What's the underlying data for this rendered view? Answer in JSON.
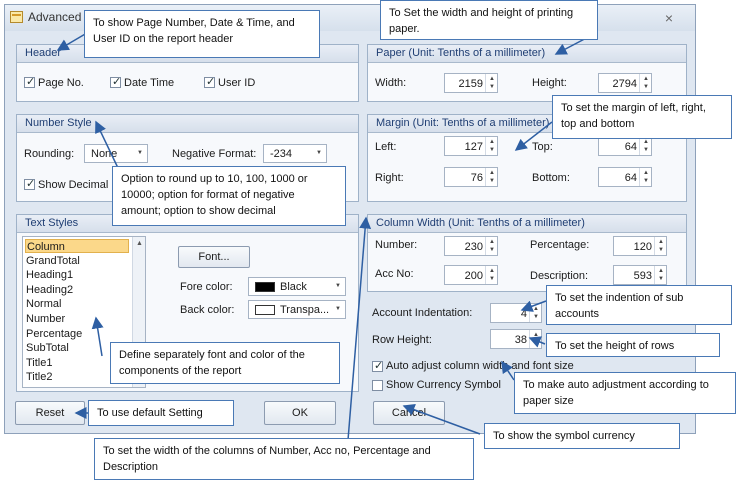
{
  "window": {
    "title": "Advanced",
    "close": "×"
  },
  "header": {
    "title": "Header",
    "page_no": {
      "label": "Page No.",
      "checked": true
    },
    "date_time": {
      "label": "Date Time",
      "checked": true
    },
    "user_id": {
      "label": "User ID",
      "checked": true
    }
  },
  "number_style": {
    "title": "Number Style",
    "rounding_label": "Rounding:",
    "rounding_value": "None",
    "negative_label": "Negative Format:",
    "negative_value": "-234",
    "show_decimal": {
      "label": "Show Decimal",
      "checked": true
    }
  },
  "text_styles": {
    "title": "Text Styles",
    "items": [
      "Column",
      "GrandTotal",
      "Heading1",
      "Heading2",
      "Normal",
      "Number",
      "Percentage",
      "SubTotal",
      "Title1",
      "Title2"
    ],
    "selected_index": 0,
    "font_button": "Font...",
    "fore_label": "Fore color:",
    "fore_value": "Black",
    "fore_swatch": "#000000",
    "back_label": "Back color:",
    "back_value": "Transpa...",
    "back_swatch": "#ffffff"
  },
  "paper": {
    "title": "Paper (Unit: Tenths of a millimeter)",
    "width_label": "Width:",
    "width_value": "2159",
    "height_label": "Height:",
    "height_value": "2794"
  },
  "margin": {
    "title": "Margin (Unit: Tenths of a millimeter)",
    "left_label": "Left:",
    "left_value": "127",
    "top_label": "Top:",
    "top_value": "64",
    "right_label": "Right:",
    "right_value": "76",
    "bottom_label": "Bottom:",
    "bottom_value": "64"
  },
  "column_width": {
    "title": "Column Width (Unit: Tenths of a millimeter)",
    "number_label": "Number:",
    "number_value": "230",
    "percentage_label": "Percentage:",
    "percentage_value": "120",
    "accno_label": "Acc No:",
    "accno_value": "200",
    "description_label": "Description:",
    "description_value": "593"
  },
  "indent": {
    "account_label": "Account Indentation:",
    "account_value": "4",
    "row_label": "Row Height:",
    "row_value": "38"
  },
  "options": {
    "auto_adjust": {
      "label": "Auto adjust column width and font size",
      "checked": true
    },
    "currency": {
      "label": "Show Currency Symbol",
      "checked": false
    }
  },
  "buttons": {
    "reset": "Reset",
    "ok": "OK",
    "cancel": "Cancel"
  },
  "notes": {
    "header": "To show Page Number, Date & Time, and User ID on the report header",
    "paper": "To Set the width and height of printing paper.",
    "margin": "To set the margin of left, right, top and bottom",
    "number_style": "Option to round up to 10, 100, 1000 or 10000; option for format of negative amount; option to show decimal",
    "indent": "To set the indention of sub accounts",
    "row_height": "To set the height of rows",
    "auto_adjust": "To make auto adjustment according to paper size",
    "text_styles": "Define separately font and color of the components of the report",
    "reset": "To use default Setting",
    "currency": "To show the symbol currency",
    "column_width": "To set the width of the columns of Number, Acc no, Percentage and Description"
  }
}
